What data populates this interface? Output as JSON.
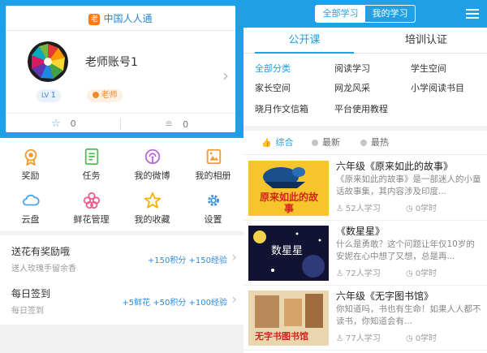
{
  "left_panel": {
    "brand": "中国人人通",
    "brand_logo_char": "老",
    "account_name": "老师账号1",
    "level": "1",
    "role": "老师",
    "stats": {
      "stars": "0",
      "coins": "0"
    },
    "grid": [
      {
        "label": "奖励",
        "icon": "medal-icon"
      },
      {
        "label": "任务",
        "icon": "task-list-icon"
      },
      {
        "label": "我的微博",
        "icon": "weibo-icon"
      },
      {
        "label": "我的相册",
        "icon": "album-icon"
      },
      {
        "label": "云盘",
        "icon": "cloud-icon"
      },
      {
        "label": "鲜花管理",
        "icon": "flower-icon"
      },
      {
        "label": "我的收藏",
        "icon": "star-icon"
      },
      {
        "label": "设置",
        "icon": "gear-icon"
      }
    ],
    "tasks": [
      {
        "title": "送花有奖励哦",
        "subtitle": "送人玫瑰手留余香",
        "reward": "+150积分 +150经验"
      },
      {
        "title": "每日签到",
        "subtitle": "每日签到",
        "reward": "+5鲜花 +50积分 +100经验"
      }
    ]
  },
  "right_panel": {
    "segments": [
      "全部学习",
      "我的学习"
    ],
    "tabs": [
      "公开课",
      "培训认证"
    ],
    "categories": [
      "全部分类",
      "阅读学习",
      "学生空间",
      "家长空间",
      "网龙风采",
      "小学阅读书目",
      "晓月作文信箱",
      "平台使用教程"
    ],
    "sorts": [
      "综合",
      "最新",
      "最热"
    ],
    "courses": [
      {
        "title": "六年级《原来如此的故事》",
        "desc": "《原来如此的故事》是一部迷人的小童话故事集，其内容涉及印度...",
        "learners": "52人学习",
        "hours": "0学时",
        "thumb_text": "原来如此的故事"
      },
      {
        "title": "《数星星》",
        "desc": "什么是勇敢？这个问题让年仅10岁的安妮在心中想了又想，总是再...",
        "learners": "72人学习",
        "hours": "0学时",
        "thumb_text": "数星星"
      },
      {
        "title": "六年级《无字图书馆》",
        "desc": "你知道吗，书也有生命！如果人人都不读书，你知道会有...",
        "learners": "77人学习",
        "hours": "0学时",
        "thumb_text": "无字书图书馆"
      }
    ]
  },
  "colors": {
    "accent": "#1e9fe6",
    "orange": "#f1892c"
  }
}
